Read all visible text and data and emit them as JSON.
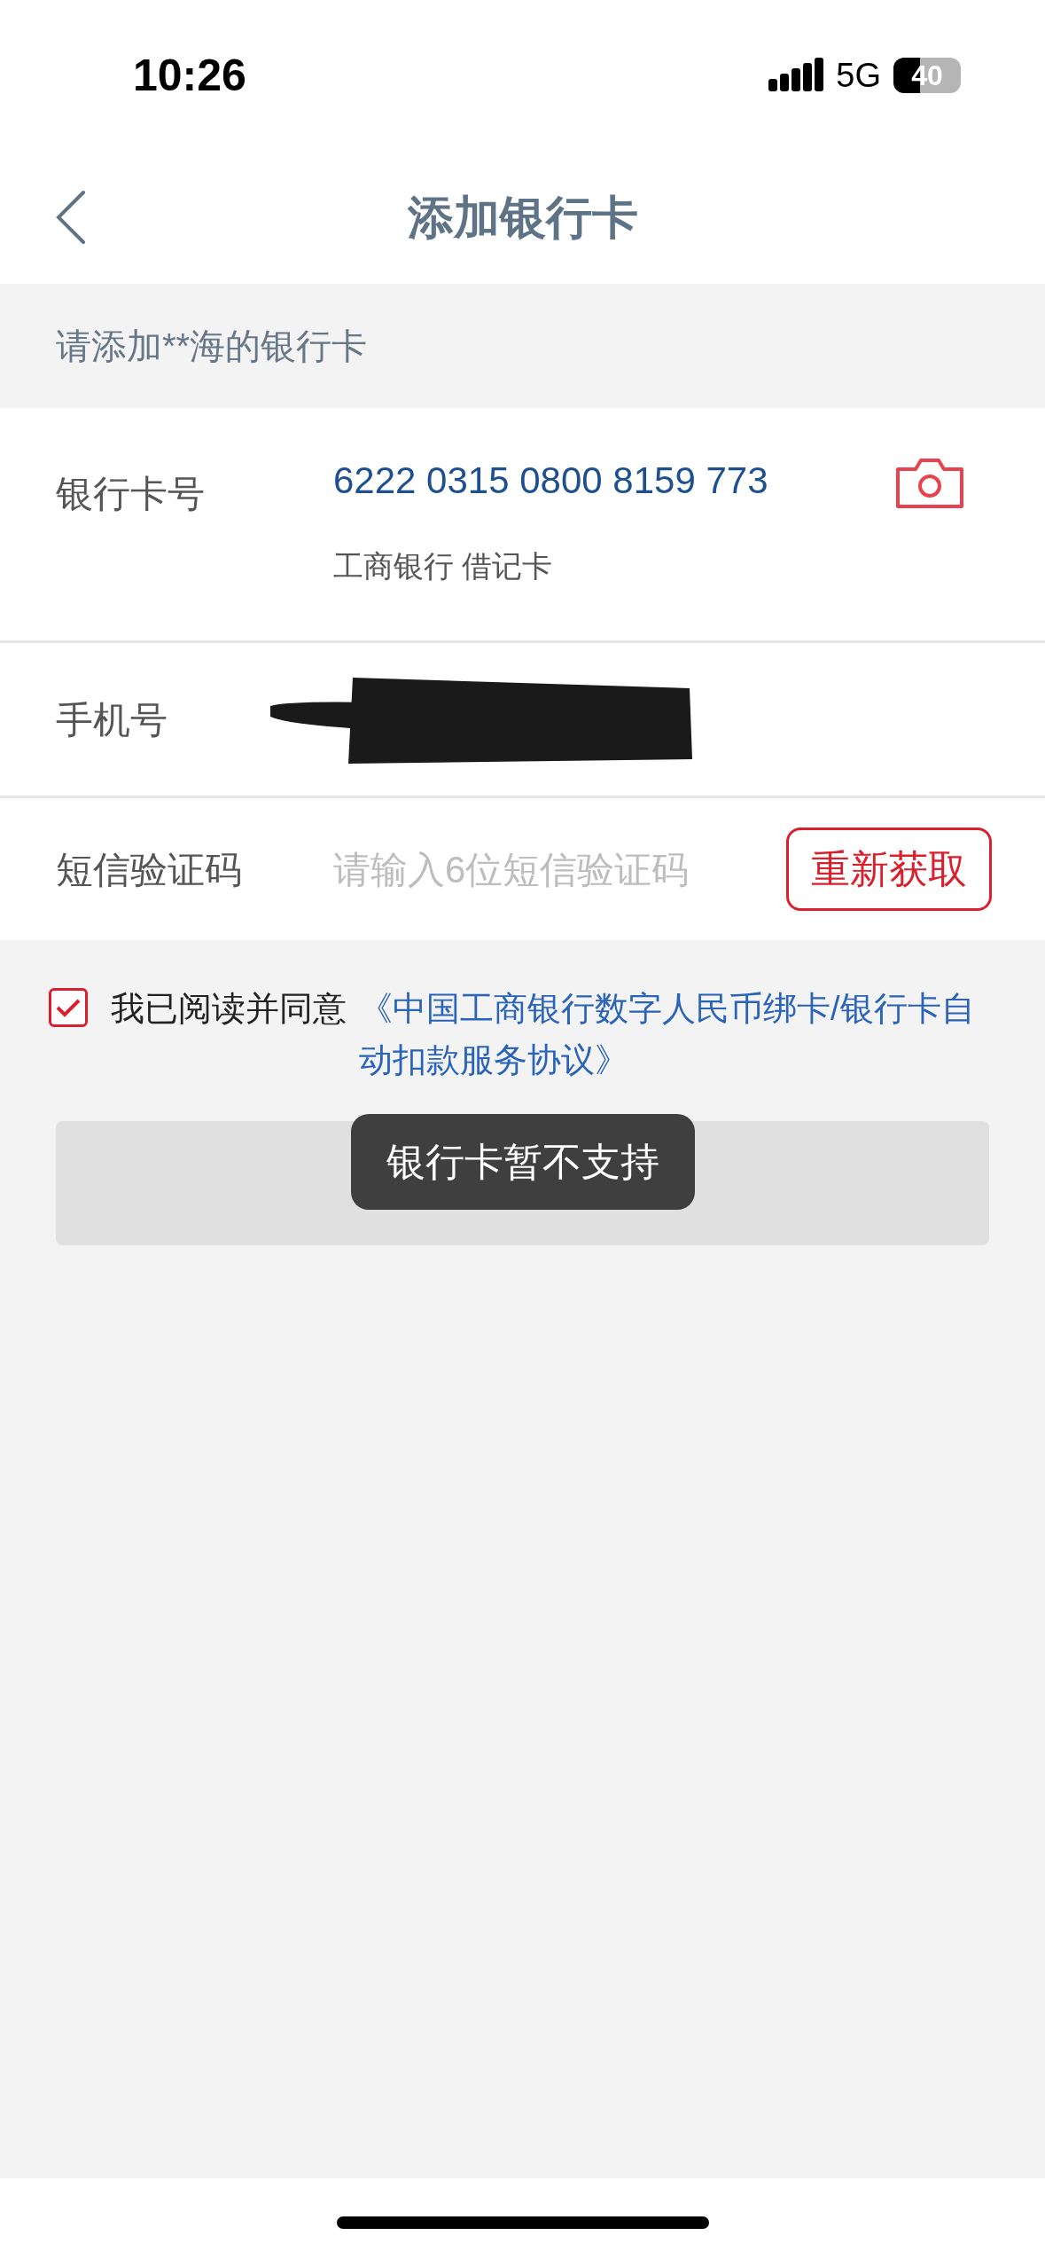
{
  "status_bar": {
    "time": "10:26",
    "network": "5G",
    "battery": "40"
  },
  "header": {
    "title": "添加银行卡"
  },
  "prompt": "请添加**海的银行卡",
  "form": {
    "card": {
      "label": "银行卡号",
      "value": "6222 0315 0800 8159 773",
      "bank_info": "工商银行 借记卡"
    },
    "phone": {
      "label": "手机号"
    },
    "sms": {
      "label": "短信验证码",
      "placeholder": "请输入6位短信验证码",
      "button": "重新获取"
    }
  },
  "agreement": {
    "checked": true,
    "text": "我已阅读并同意",
    "link": "《中国工商银行数字人民币绑卡/银行卡自动扣款服务协议》"
  },
  "confirm": {
    "disabled": true
  },
  "toast": "银行卡暂不支持"
}
